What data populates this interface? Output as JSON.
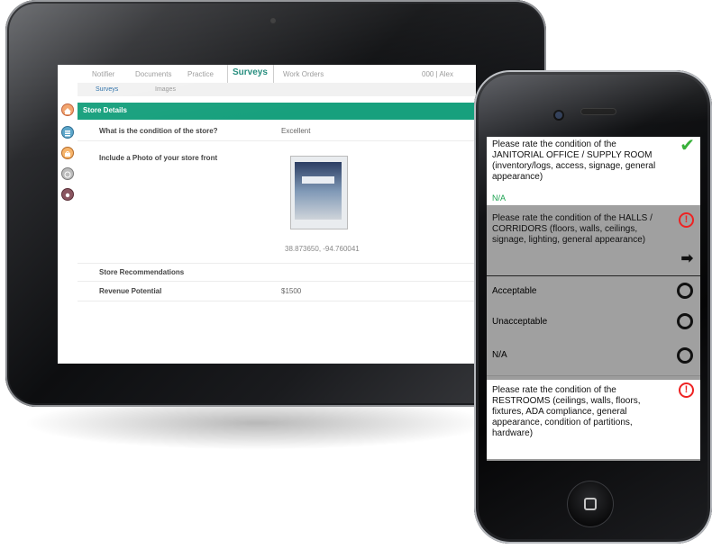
{
  "tablet": {
    "tabs": [
      "Notifier",
      "Documents",
      "Practice",
      "Surveys",
      "Work Orders",
      "000 | Alex"
    ],
    "subtabs": [
      "Surveys",
      "Images"
    ],
    "section_header": "Store Details",
    "rows": [
      {
        "question": "What is the condition of the store?",
        "answer": "Excellent"
      },
      {
        "question": "Include a Photo of your store front",
        "answer": ""
      },
      {
        "question": "Store Recommendations",
        "answer": ""
      },
      {
        "question": "Revenue Potential",
        "answer": "$1500"
      }
    ],
    "photo_coords": "38.873650, -94.760041",
    "photo_sign_text": "Lorem",
    "sidebar_icons": [
      "home-icon",
      "list-icon",
      "bag-icon",
      "clock-icon",
      "gear-icon"
    ],
    "colors": {
      "accent": "#17a07d",
      "active_tab": "#1f8a7a"
    }
  },
  "phone": {
    "q1": "Please rate the condition of the JANITORIAL OFFICE / SUPPLY ROOM (inventory/logs, access, signage, general appearance)",
    "q1_answer": "N/A",
    "q2": "Please rate the condition of the HALLS / CORRIDORS (floors, walls, ceilings, signage, lighting, general appearance)",
    "options": [
      "Acceptable",
      "Unacceptable",
      "N/A"
    ],
    "q3": "Please rate the condition of the RESTROOMS (ceilings, walls, floors, fixtures, ADA compliance, general appearance, condition of partitions, hardware)",
    "icons": {
      "complete": "checkmark-icon",
      "alert": "alert-icon",
      "next": "arrow-right-icon"
    },
    "colors": {
      "check": "#38b13a",
      "alert": "#e22222",
      "na": "#1aa14f"
    }
  }
}
